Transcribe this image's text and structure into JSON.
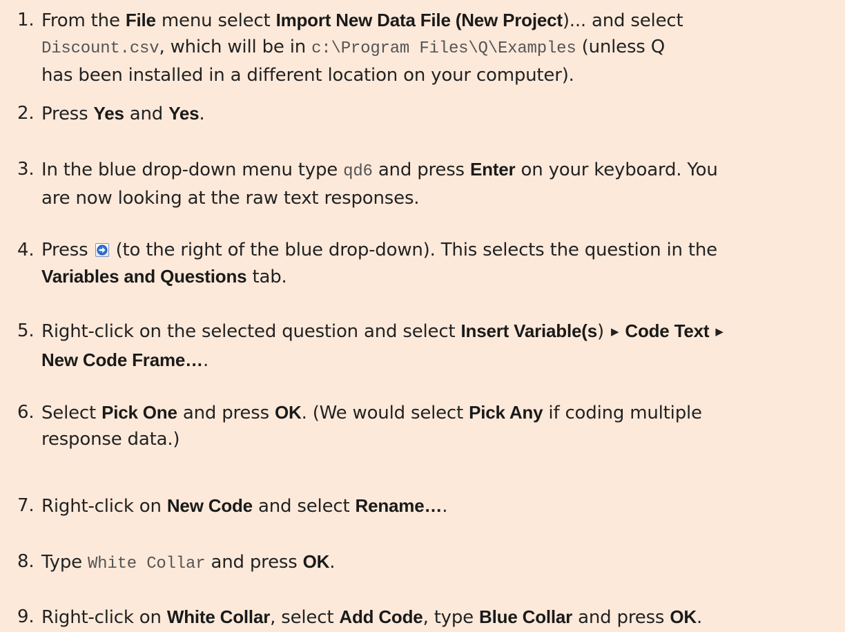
{
  "steps": [
    {
      "num": "1.",
      "lines": [
        {
          "t1": "From the ",
          "b1": "File",
          "t2": " menu select ",
          "b2": "Import New Data File (New Project",
          "t3": ")... and select"
        },
        {
          "m1": "Discount.csv",
          "t1": ", which will be in ",
          "m2": "c:\\Program Files\\Q\\Examples",
          "t2": " (unless Q"
        },
        {
          "t1": "has been installed in a different location on your computer)."
        }
      ]
    },
    {
      "num": "2.",
      "t1": "Press ",
      "b1": "Yes",
      "t2": " and ",
      "b2": "Yes",
      "t3": "."
    },
    {
      "num": "3.",
      "lines": [
        {
          "t1": "In the blue drop-down menu type ",
          "m1": "qd6",
          "t2": " and press ",
          "b1": "Enter",
          "t3": " on your keyboard.  You"
        },
        {
          "t1": "are now looking at the raw text responses."
        }
      ]
    },
    {
      "num": "4.",
      "icon": "go-to-question-icon",
      "lines": [
        {
          "t1": "Press ",
          "t2": " (to the right of the blue drop-down).  This selects the question in the"
        },
        {
          "b1": "Variables and Questions",
          "t1": " tab."
        }
      ]
    },
    {
      "num": "5.",
      "lines": [
        {
          "t1": "Right-click on the selected question and select ",
          "b1": "Insert Variable(s",
          "t2": ") ",
          "a1": "▶",
          "b2": " Code Text ",
          "a2": "▶"
        },
        {
          "b1": "New Code Frame…",
          "t1": "."
        }
      ]
    },
    {
      "num": "6.",
      "lines": [
        {
          "t1": "Select ",
          "b1": "Pick One",
          "t2": " and press ",
          "b2": "OK",
          "t3": ".  (We would select ",
          "b3": "Pick Any",
          "t4": " if coding multiple"
        },
        {
          "t1": "response data.)"
        }
      ]
    },
    {
      "num": "7.",
      "t1": "Right-click on ",
      "b1": "New Code",
      "t2": " and select ",
      "b2": "Rename…",
      "t3": "."
    },
    {
      "num": "8.",
      "t1": "Type ",
      "m1": "White Collar",
      "t2": " and press ",
      "b1": "OK",
      "t3": "."
    },
    {
      "num": "9.",
      "t1": "Right-click on ",
      "b1": "White Collar",
      "t2": ", select ",
      "b2": "Add Code",
      "t3": ", type ",
      "b3": "Blue Collar",
      "t4": " and press ",
      "b4": "OK",
      "t5": "."
    }
  ]
}
